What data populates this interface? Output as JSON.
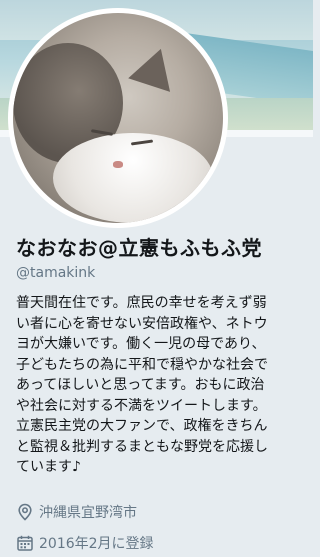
{
  "profile": {
    "display_name": "なおなお@立憲もふもふ党",
    "handle": "@tamakink",
    "bio_lines": [
      "普天間在住です。庶民の幸せを考えず弱",
      "い者に心を寄せない安倍政権や、ネトウ",
      "ヨが大嫌いです。働く一児の母であり、",
      "子どもたちの為に平和で穏やかな社会で",
      "あってほしいと思ってます。おもに政治",
      "や社会に対する不満をツイートします。",
      "立憲民主党の大ファンで、政権をきちん",
      "と監視＆批判するまともな野党を応援し",
      "ています♪"
    ],
    "location": "沖縄県宜野湾市",
    "joined": "2016年2月に登録"
  },
  "icons": {
    "location": "location-pin-icon",
    "joined": "calendar-icon"
  },
  "colors": {
    "background": "#e6ecf0",
    "text_primary": "#14171a",
    "text_secondary": "#657786"
  }
}
